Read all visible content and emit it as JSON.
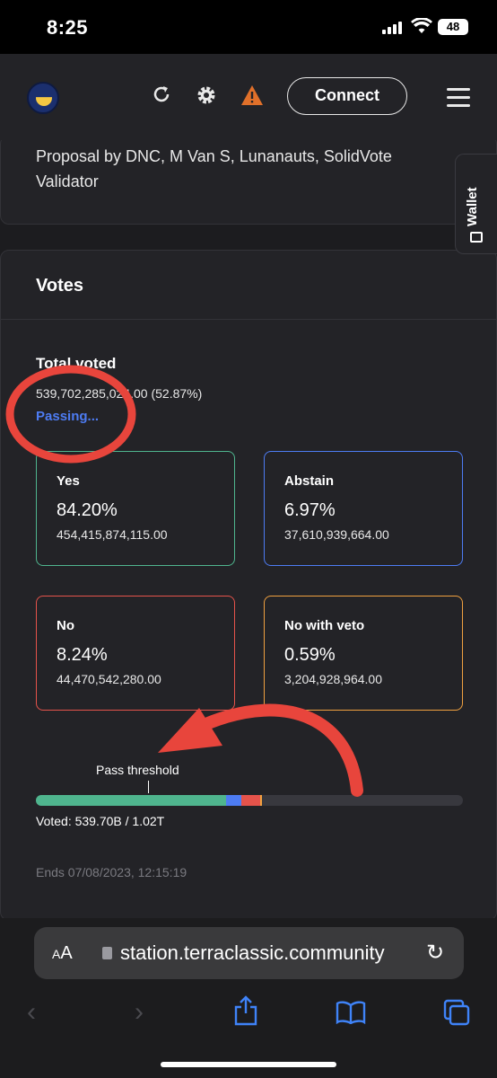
{
  "status_bar": {
    "time": "8:25",
    "battery": "48"
  },
  "topbar": {
    "connect_label": "Connect"
  },
  "proposal": {
    "author_line": "Proposal by DNC, M Van S, Lunanauts, SolidVote Validator"
  },
  "wallet_tab": {
    "label": "Wallet"
  },
  "votes": {
    "title": "Votes",
    "total_voted_label": "Total voted",
    "total_voted_amount": "539,702,285,024.00 (52.87%)",
    "status": "Passing...",
    "options": [
      {
        "label": "Yes",
        "percent": "84.20%",
        "amount": "454,415,874,115.00",
        "color": "#4fb58e"
      },
      {
        "label": "Abstain",
        "percent": "6.97%",
        "amount": "37,610,939,664.00",
        "color": "#4d7cf3"
      },
      {
        "label": "No",
        "percent": "8.24%",
        "amount": "44,470,542,280.00",
        "color": "#e5534b"
      },
      {
        "label": "No with veto",
        "percent": "0.59%",
        "amount": "3,204,928,964.00",
        "color": "#f0a140"
      }
    ],
    "pass_threshold_label": "Pass threshold",
    "voted_text": "Voted: 539.70B / 1.02T",
    "ends_text": "Ends 07/08/2023, 12:15:19",
    "bar_fraction": {
      "yes": 0.445,
      "abstain": 0.037,
      "no": 0.044,
      "veto": 0.003
    }
  },
  "browser": {
    "aa_label": "AA",
    "url": "station.terraclassic.community"
  },
  "icons": [
    "terra-logo-icon",
    "refresh-icon",
    "gear-icon",
    "warning-icon",
    "menu-icon",
    "wallet-icon",
    "lock-icon",
    "reload-icon",
    "back-icon",
    "forward-icon",
    "share-icon",
    "bookmarks-icon",
    "tabs-icon"
  ]
}
